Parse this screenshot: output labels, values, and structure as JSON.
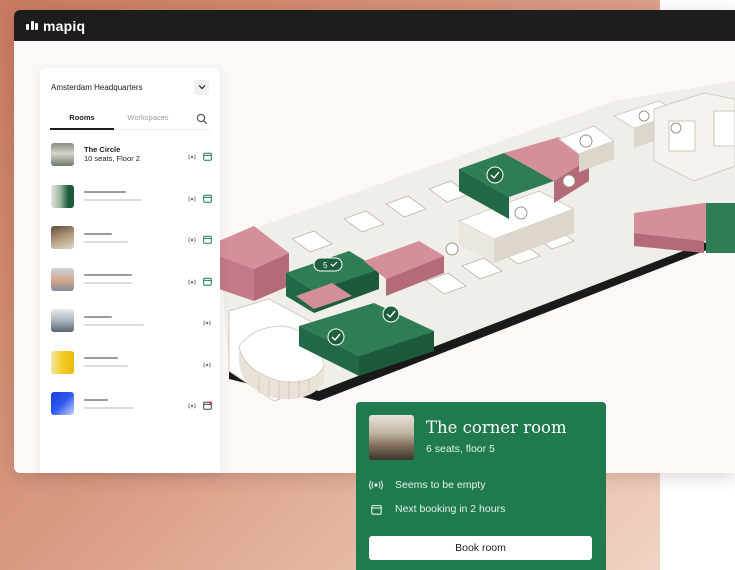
{
  "app": {
    "logo_text": "mapiq"
  },
  "sidebar": {
    "location": "Amsterdam Headquarters",
    "tabs": [
      {
        "label": "Rooms",
        "active": true
      },
      {
        "label": "Workspaces",
        "active": false
      }
    ],
    "rooms": [
      {
        "name": "The Circle",
        "details": "10 seats, Floor 2",
        "thumb": "office-photo",
        "icons": [
          "sensor-icon",
          "calendar-icon"
        ]
      },
      {
        "thumb": "green-gradient",
        "icons": [
          "sensor-icon",
          "calendar-icon"
        ]
      },
      {
        "thumb": "office-photo",
        "icons": [
          "sensor-icon",
          "calendar-icon"
        ]
      },
      {
        "thumb": "office-photo",
        "icons": [
          "sensor-icon",
          "calendar-icon"
        ]
      },
      {
        "thumb": "office-photo",
        "icons": [
          "sensor-icon"
        ]
      },
      {
        "thumb": "yellow-gradient",
        "icons": [
          "sensor-icon"
        ]
      },
      {
        "thumb": "blue-gradient",
        "icons": [
          "sensor-icon",
          "calendar-icon"
        ]
      }
    ]
  },
  "map": {
    "room_badge_count": "5",
    "colors": {
      "available": "#2e7d55",
      "occupied": "#d08a96",
      "floor": "#f0eee9"
    }
  },
  "popup": {
    "title": "The corner room",
    "details": "6 seats, floor 5",
    "status": "Seems to be empty",
    "next_booking": "Next booking in 2 hours",
    "book_label": "Book room"
  },
  "colors": {
    "brand_green": "#1f7a4d",
    "topbar": "#1d1d1d"
  }
}
